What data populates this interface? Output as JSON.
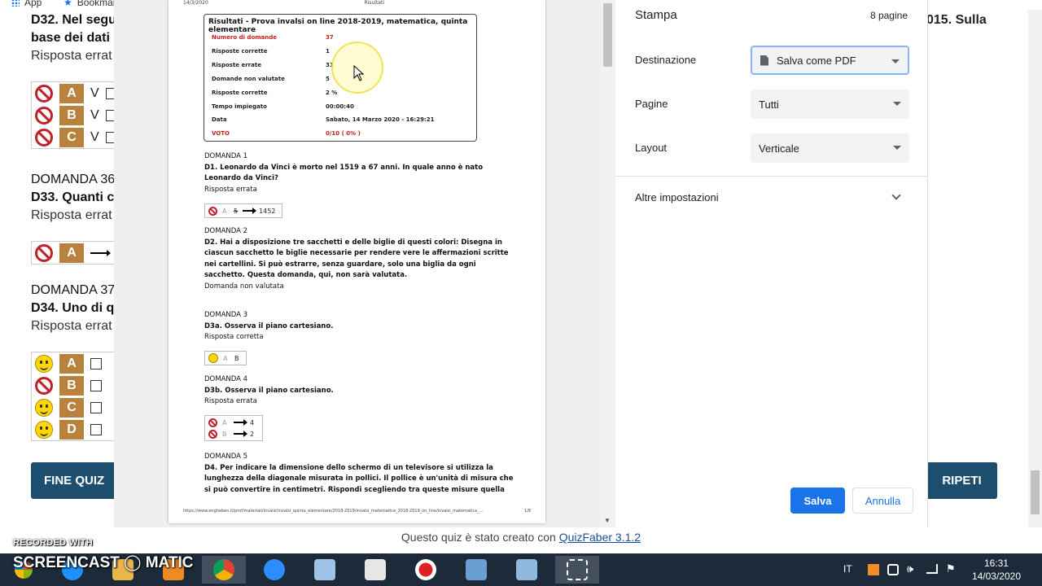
{
  "bookmarks": {
    "apps": "App",
    "bookmarks": "Bookmarks"
  },
  "quiz": {
    "q32_title_a": "D32. Nel segu",
    "q32_title_b": "base dei dati",
    "q32_status": "Risposta errat",
    "q32_right": "015. Sulla",
    "q32_answers": [
      {
        "letter": "A",
        "mark": "V"
      },
      {
        "letter": "B",
        "mark": "V"
      },
      {
        "letter": "C",
        "mark": "V"
      }
    ],
    "q33_num": "DOMANDA 36",
    "q33_title": "D33. Quanti c",
    "q33_status": "Risposta errat",
    "q33_answer_letter": "A",
    "q34_num": "DOMANDA 37",
    "q34_title": "D34. Uno di q",
    "q34_status": "Risposta errat",
    "q34_answers": [
      {
        "letter": "A",
        "icon": "smile"
      },
      {
        "letter": "B",
        "icon": "no"
      },
      {
        "letter": "C",
        "icon": "smile"
      },
      {
        "letter": "D",
        "icon": "smile"
      }
    ],
    "end_button": "FINE QUIZ",
    "repeat_button": "RIPETI",
    "credit_text": "Questo quiz è stato creato con",
    "credit_link": "QuizFaber 3.1.2"
  },
  "preview": {
    "header_date": "14/3/2020",
    "header_title": "Risultati",
    "results_title": "Risultati - Prova invalsi on line 2018-2019, matematica, quinta elementare",
    "results": [
      {
        "label": "Numero di domande",
        "value": "37",
        "red": true
      },
      {
        "label": "Risposte corrette",
        "value": "1",
        "red": false
      },
      {
        "label": "Risposte errate",
        "value": "31",
        "red": false
      },
      {
        "label": "Domande non valutate",
        "value": "5",
        "red": false
      },
      {
        "label": "Risposte corrette",
        "value": "2 %",
        "red": false
      },
      {
        "label": "Tempo impiegato",
        "value": "00:00:40",
        "red": false
      },
      {
        "label": "Data",
        "value": "Sabato, 14 Marzo 2020 - 16:29:21",
        "red": false
      },
      {
        "label": "VOTO",
        "value": "0/10 ( 0% )",
        "red": true
      }
    ],
    "d1_num": "DOMANDA 1",
    "d1_title": "D1. Leonardo da Vinci è morto nel 1519 a 67 anni. In quale anno è nato Leonardo da Vinci?",
    "d1_status": "Risposta errata",
    "d1_ans_letter": "A",
    "d1_ans_wrong": "5",
    "d1_ans_right": "1452",
    "d2_num": "DOMANDA 2",
    "d2_title": "D2. Hai a disposizione tre sacchetti e delle biglie di questi colori: Disegna in ciascun sacchetto le biglie necessarie per rendere vere le affermazioni scritte nei cartellini. Si può estrarre, senza guardare, solo una biglia da ogni sacchetto. Questa domanda, qui, non sarà valutata.",
    "d2_status": "Domanda non valutata",
    "d3_num": "DOMANDA 3",
    "d3_title": "D3a. Osserva il piano cartesiano.",
    "d3_status": "Risposta corretta",
    "d3_ans_letter": "A",
    "d3_ans_value": "B",
    "d4_num": "DOMANDA 4",
    "d4_title": "D3b. Osserva il piano cartesiano.",
    "d4_status": "Risposta errata",
    "d4_answers": [
      {
        "letter": "A",
        "value": "4"
      },
      {
        "letter": "B",
        "value": "2"
      }
    ],
    "d5_num": "DOMANDA 5",
    "d5_title": "D4. Per indicare la dimensione dello schermo di un televisore si utilizza la lunghezza della diagonale misurata in pollici. Il pollice è un'unità di misura che si può convertire in centimetri. Rispondi scegliendo tra queste misure quella",
    "footer_url": "https://www.engheben.it/prof/materiali/invalsi/invalsi_quinta_elementare/2018-2019/invalsi_matematica_2018-2019_on_line/invalsi_matematica_...",
    "footer_page": "1/8"
  },
  "print": {
    "title": "Stampa",
    "pages_count": "8 pagine",
    "dest_label": "Destinazione",
    "dest_value": "Salva come PDF",
    "pages_label": "Pagine",
    "pages_value": "Tutti",
    "layout_label": "Layout",
    "layout_value": "Verticale",
    "more_settings": "Altre impostazioni",
    "save": "Salva",
    "cancel": "Annulla"
  },
  "watermark": {
    "line1": "RECORDED WITH",
    "line2": "SCREENCAST ◯ MATIC"
  },
  "taskbar": {
    "lang": "IT",
    "time": "16:31",
    "date": "14/03/2020"
  },
  "colors": {
    "accent": "#1a73e8",
    "quiz_dark": "#1e4e6e",
    "letter_bg": "#b8823c",
    "error_red": "#c0212b"
  }
}
